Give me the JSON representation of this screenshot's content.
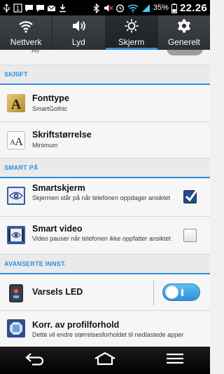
{
  "status_bar": {
    "battery_percent": "35%",
    "time": "22.26",
    "notification_badge": "1",
    "icons": [
      "usb-icon",
      "notification-icon",
      "message-icon",
      "message-icon",
      "email-icon",
      "download-icon",
      "bluetooth-icon",
      "mute-icon",
      "alarm-icon",
      "wifi-icon",
      "signal-icon",
      "battery-icon"
    ]
  },
  "tabs": [
    {
      "label": "Nettverk",
      "icon": "wifi-icon",
      "active": false
    },
    {
      "label": "Lyd",
      "icon": "speaker-icon",
      "active": false
    },
    {
      "label": "Skjerm",
      "icon": "brightness-icon",
      "active": true
    },
    {
      "label": "Generelt",
      "icon": "gear-icon",
      "active": false
    }
  ],
  "partial_row": {
    "value": "Av"
  },
  "sections": {
    "font": "SKRIFT",
    "smart": "SMART PÅ",
    "advanced": "AVANSERTE INNST."
  },
  "rows": {
    "fonttype": {
      "title": "Fonttype",
      "subtitle": "SmartGothic"
    },
    "font_size": {
      "title": "Skriftstørrelse",
      "subtitle": "Minimum"
    },
    "smart_screen": {
      "title": "Smartskjerm",
      "subtitle": "Skjermen står på når telefonen oppdager ansiktet",
      "checked": true
    },
    "smart_video": {
      "title": "Smart video",
      "subtitle": "Video pauser når telefonen ikke oppfatter ansiktet",
      "checked": false
    },
    "notification_led": {
      "title": "Varsels LED",
      "enabled": true
    },
    "aspect_ratio": {
      "title": "Korr. av profilforhold",
      "subtitle": "Dette vil endre størrelsesforholdet til nedlastede apper"
    }
  },
  "colors": {
    "accent": "#2d8fe0",
    "checkbox_on": "#244a8c",
    "switch_on": "#3aa4e6"
  }
}
